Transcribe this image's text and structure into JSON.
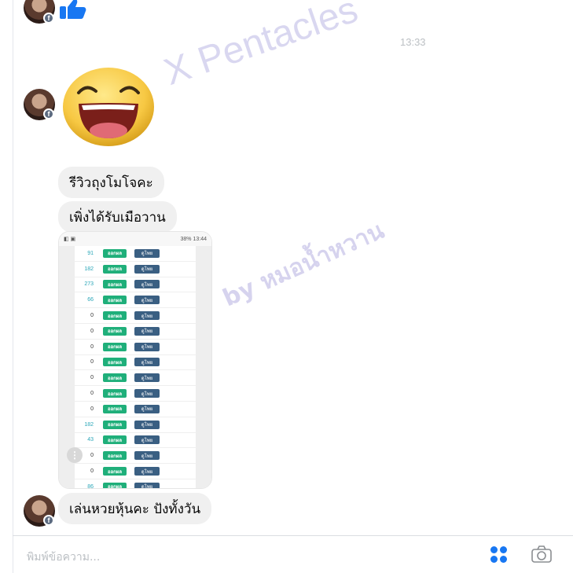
{
  "thread": {
    "timestamp": "13:33",
    "messages": [
      {
        "type": "sticker",
        "sticker": "like-thumb"
      },
      {
        "type": "sticker",
        "sticker": "laughing-face"
      },
      {
        "type": "text",
        "text": "รีวิวถุงโมโจคะ"
      },
      {
        "type": "text",
        "text": "เพิ่งได้รับเมือวาน"
      },
      {
        "type": "image",
        "description": "lottery results screenshot"
      },
      {
        "type": "text",
        "text": "เล่นหวยหุ้นคะ ปังทั้งวัน"
      }
    ]
  },
  "watermarks": {
    "line1": "X Pentacles",
    "line2": "by หมอน้ำหวาน"
  },
  "screenshot": {
    "status_right": "38% 13:44",
    "result_label": "ออกผล",
    "view_label": "ดูโพย",
    "numbers": [
      "91",
      "182",
      "273",
      "66",
      "0",
      "0",
      "0",
      "0",
      "0",
      "0",
      "0",
      "182",
      "43",
      "0",
      "0",
      "86"
    ]
  },
  "composer": {
    "placeholder": "พิมพ์ข้อความ..."
  },
  "colors": {
    "accent": "#1877f2",
    "bubble": "#f0f0f0",
    "result_button": "#1faf7a",
    "view_button": "#3a5f82",
    "watermark": "#786ec8"
  },
  "icons": {
    "sticker": "sticker-grid-icon",
    "camera": "camera-icon",
    "more": "more-options-icon"
  }
}
